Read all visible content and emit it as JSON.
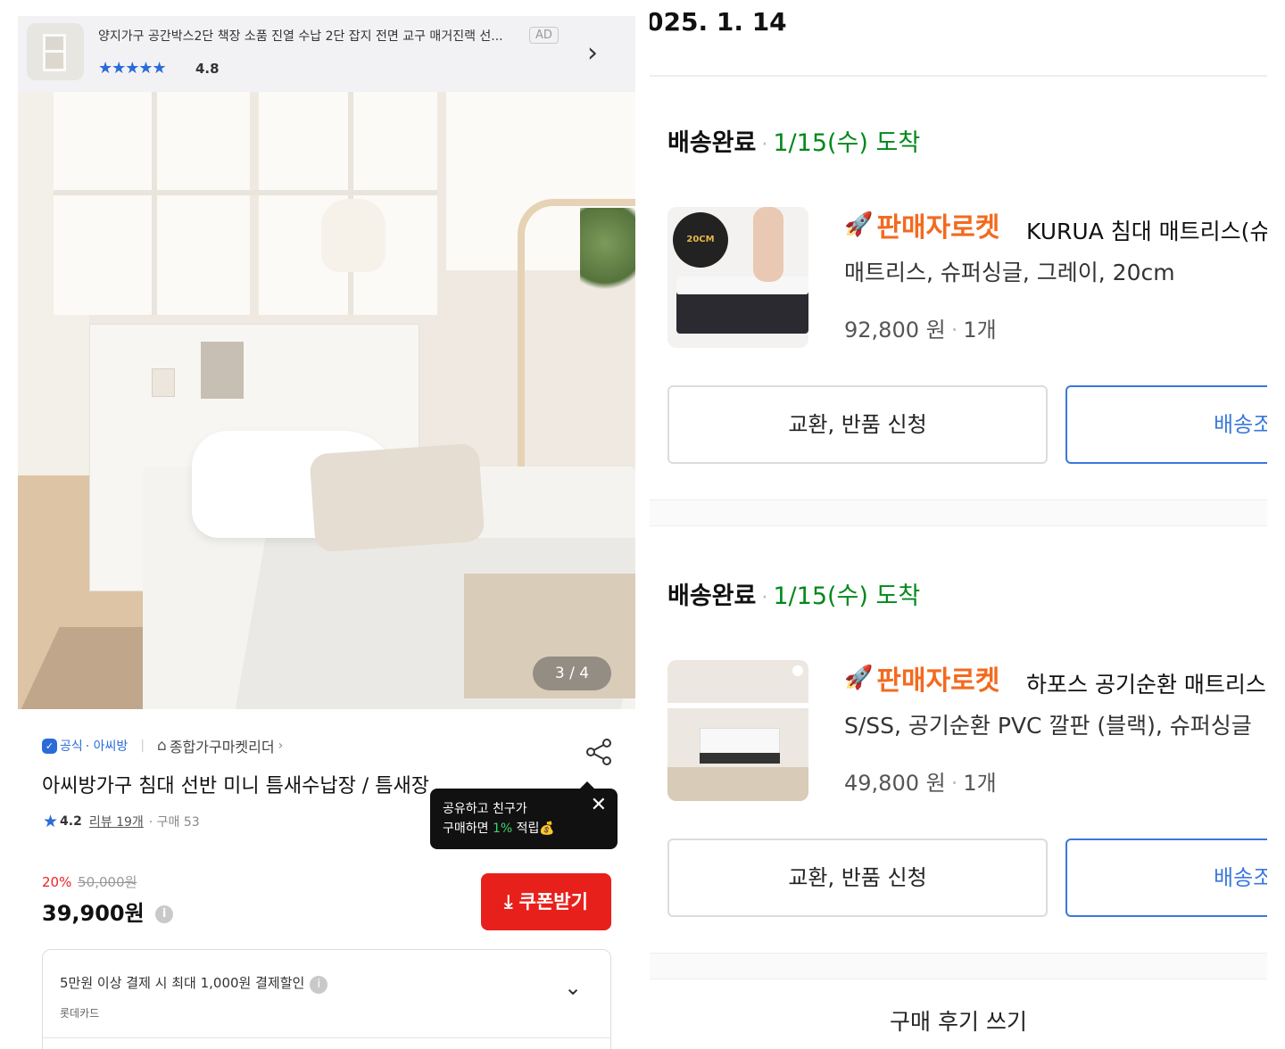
{
  "left": {
    "ad": {
      "title": "양지가구 공간박스2단 책장 소품 진열 수납 2단 잡지 전면 교구 매거진랙 선...",
      "badge": "AD",
      "stars": "★★★★★",
      "rating": "4.8",
      "chevron": "›"
    },
    "image_counter": "3 / 4",
    "seller": {
      "official": "공식",
      "name": "· 아씨방",
      "separator": "|",
      "leader": "종합가구마켓리더",
      "leader_chevron": "›"
    },
    "product_title": "아씨방가구 침대 선반 미니 틈새수납장 / 틈새장",
    "rating": {
      "star": "★",
      "value": "4.2",
      "reviews": "리뷰 19개",
      "purchases": "· 구매 53"
    },
    "tooltip": {
      "line1": "공유하고 친구가",
      "line2_pre": "구매하면 ",
      "line2_green": "1%",
      "line2_post": " 적립💰",
      "close": "✕"
    },
    "price": {
      "discount_rate": "20%",
      "original": "50,000원",
      "final": "39,900원",
      "info": "i"
    },
    "coupon_button": "⤓ 쿠폰받기",
    "payment": {
      "text": "5만원 이상 결제 시 최대 1,000원 결제할인",
      "info": "i",
      "card": "롯데카드",
      "chevron": "⌄"
    }
  },
  "right": {
    "order_date": "025. 1. 14",
    "orders": [
      {
        "status": "배송완료",
        "dot": "·",
        "arrival": "1/15(수) 도착",
        "rocket": "판매자로켓",
        "name": "KURUA 침대 매트리스(슈퍼",
        "option": "매트리스, 슈퍼싱글, 그레이, 20cm",
        "price": "92,800 원",
        "qty": "1개",
        "exchange": "교환, 반품 신청",
        "delivery": "배송조회"
      },
      {
        "status": "배송완료",
        "dot": "·",
        "arrival": "1/15(수) 도착",
        "rocket": "판매자로켓",
        "name": "하포스 공기순환 매트리스 퀸",
        "option": "S/SS, 공기순환 PVC 깔판 (블랙), 슈퍼싱글",
        "price": "49,800 원",
        "qty": "1개",
        "exchange": "교환, 반품 신청",
        "delivery": "배송조회"
      }
    ],
    "review_button": "구매 후기 쓰기"
  },
  "colors": {
    "accent_blue": "#2a6bd8",
    "coupon_red": "#e8201c",
    "arrival_green": "#00891a",
    "rocket_orange": "#f36a1f"
  }
}
